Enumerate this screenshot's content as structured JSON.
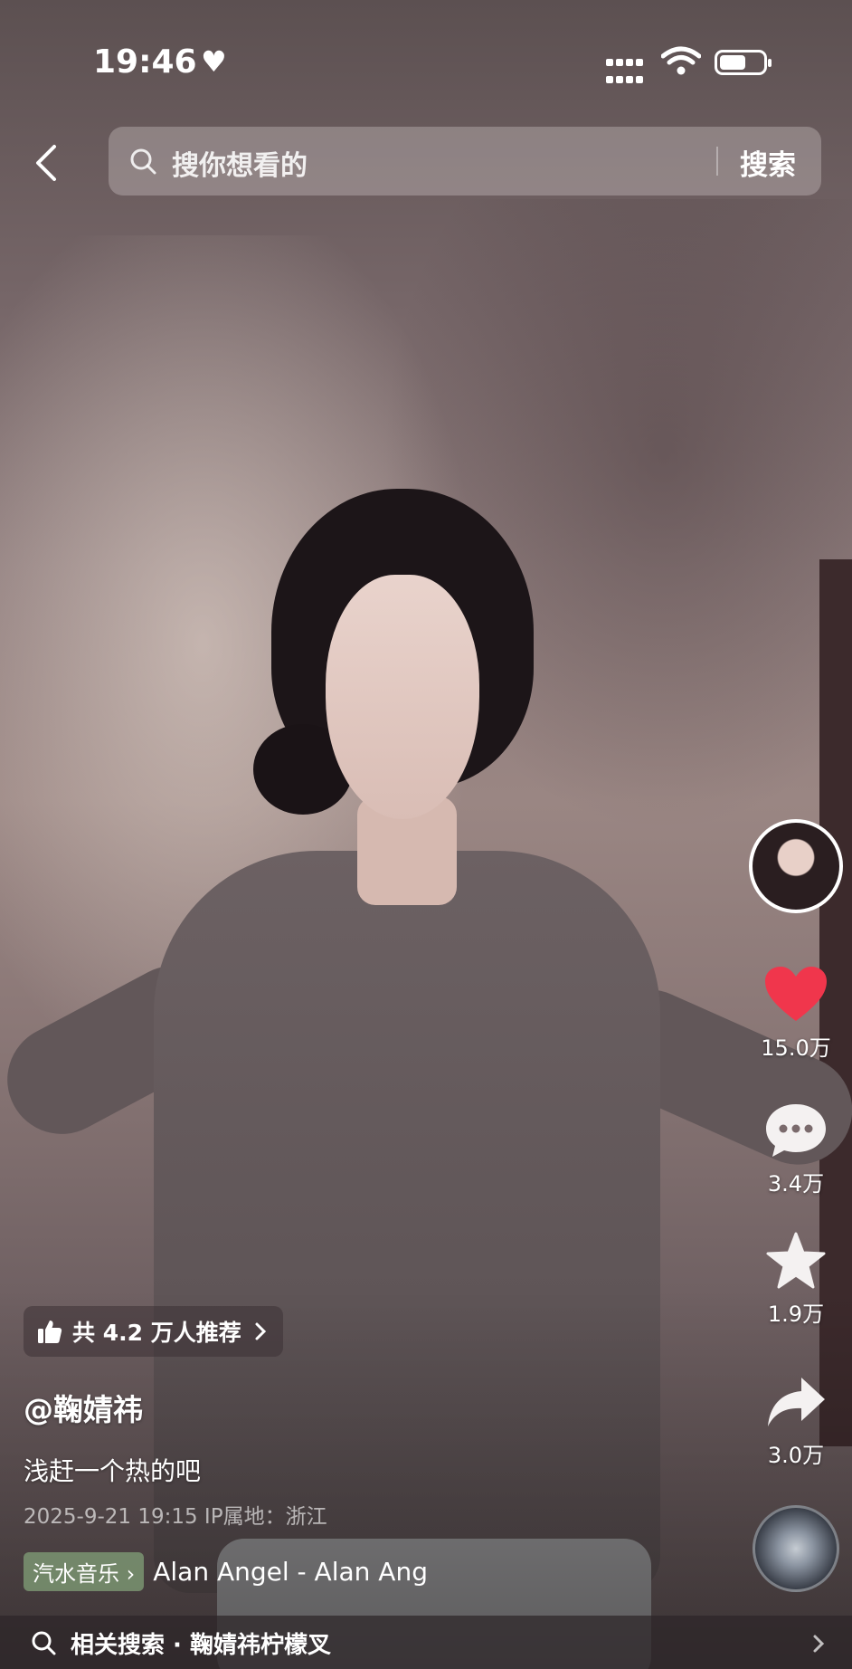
{
  "status_bar": {
    "time": "19:46",
    "heart": "♥"
  },
  "search": {
    "placeholder": "搜你想看的",
    "button_label": "搜索"
  },
  "actions": {
    "likes": "15.0万",
    "comments": "3.4万",
    "favorites": "1.9万",
    "shares": "3.0万"
  },
  "recommend": {
    "label": "共 4.2 万人推荐"
  },
  "video": {
    "author": "@鞠婧祎",
    "caption": "浅赶一个热的吧",
    "meta": "2025-9-21 19:15  IP属地：浙江"
  },
  "music": {
    "tag": "汽水音乐 ›",
    "title": "Alan   Angel - Alan   Ang"
  },
  "related": {
    "label": "相关搜索 · 鞠婧祎柠檬叉"
  },
  "colors": {
    "like_red": "#f0364c",
    "music_tag_green": "#82a078"
  },
  "icons": {
    "back": "chevron-left-icon",
    "search": "search-icon",
    "like": "heart-icon",
    "comment": "comment-bubble-icon",
    "favorite": "star-icon",
    "share": "share-arrow-icon",
    "recommend": "thumbs-up-icon"
  }
}
